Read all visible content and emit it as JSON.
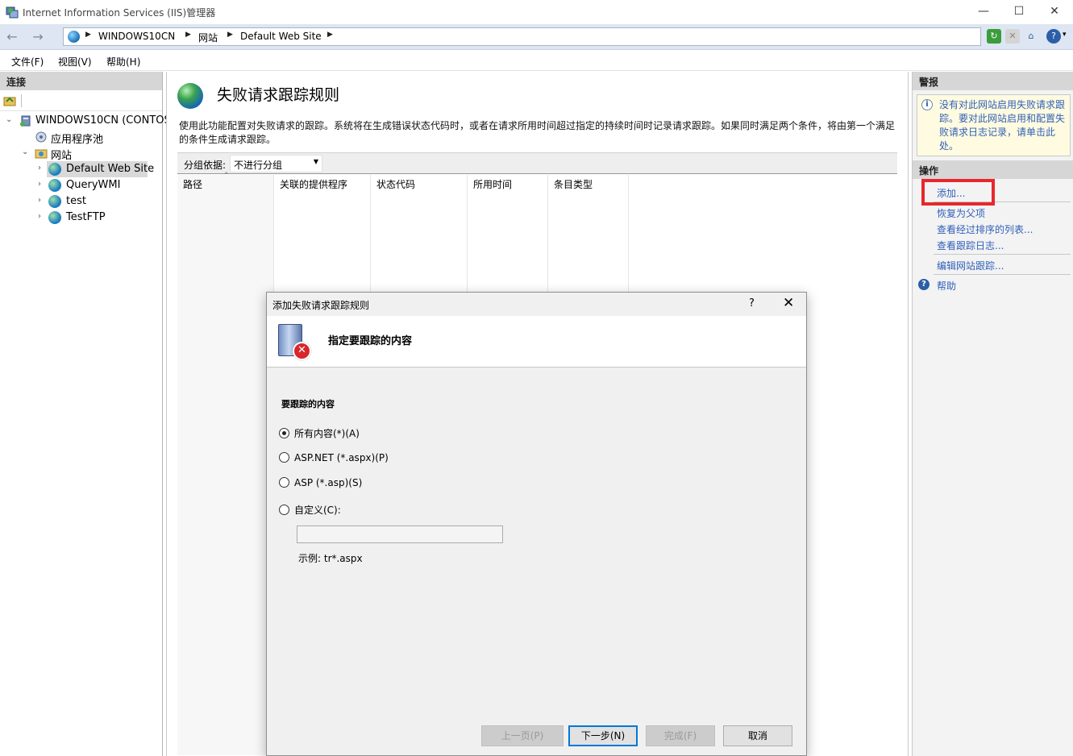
{
  "window": {
    "title": "Internet Information Services (IIS)管理器",
    "min_icon": "—",
    "max_icon": "☐",
    "close_icon": "✕"
  },
  "address": {
    "back": "←",
    "forward": "→",
    "crumbs": [
      "WINDOWS10CN",
      "网站",
      "Default Web Site"
    ],
    "arrow": "▶",
    "dropdown_caret": "▾"
  },
  "menu": [
    "文件(F)",
    "视图(V)",
    "帮助(H)"
  ],
  "left": {
    "header": "连接",
    "tree": [
      {
        "label": "WINDOWS10CN (CONTOSO",
        "expander": "⌄"
      },
      {
        "label": "应用程序池",
        "expander": ""
      },
      {
        "label": "网站",
        "expander": "⌄"
      },
      {
        "label": "Default Web Site",
        "expander": "›"
      },
      {
        "label": "QueryWMI",
        "expander": "›"
      },
      {
        "label": "test",
        "expander": "›"
      },
      {
        "label": "TestFTP",
        "expander": "›"
      }
    ]
  },
  "center": {
    "title": "失败请求跟踪规则",
    "description": "使用此功能配置对失败请求的跟踪。系统将在生成错误状态代码时，或者在请求所用时间超过指定的持续时间时记录请求跟踪。如果同时满足两个条件，将由第一个满足的条件生成请求跟踪。",
    "group_label": "分组依据:",
    "group_value": "不进行分组",
    "group_caret": "▼",
    "columns": [
      "路径",
      "关联的提供程序",
      "状态代码",
      "所用时间",
      "条目类型"
    ],
    "sort_indicator": "^"
  },
  "right": {
    "alerts_header": "警报",
    "alert_text": "没有对此网站启用失败请求跟踪。要对此网站启用和配置失败请求日志记录，请单击此处。",
    "info_glyph": "i",
    "actions_header": "操作",
    "actions": [
      "添加...",
      "恢复为父项",
      "查看经过排序的列表...",
      "查看跟踪日志...",
      "编辑网站跟踪..."
    ],
    "help": "帮助",
    "help_glyph": "?"
  },
  "dialog": {
    "title": "添加失败请求跟踪规则",
    "help_button": "?",
    "close_button": "✕",
    "heading": "指定要跟踪的内容",
    "error_glyph": "✕",
    "section_label": "要跟踪的内容",
    "options": [
      {
        "label": "所有内容(*)(A)",
        "checked": true
      },
      {
        "label": "ASP.NET (*.aspx)(P)",
        "checked": false
      },
      {
        "label": "ASP (*.asp)(S)",
        "checked": false
      },
      {
        "label": "自定义(C):",
        "checked": false
      }
    ],
    "custom_value": "",
    "example": "示例: tr*.aspx",
    "buttons": {
      "prev": "上一页(P)",
      "next": "下一步(N)",
      "finish": "完成(F)",
      "cancel": "取消"
    }
  }
}
